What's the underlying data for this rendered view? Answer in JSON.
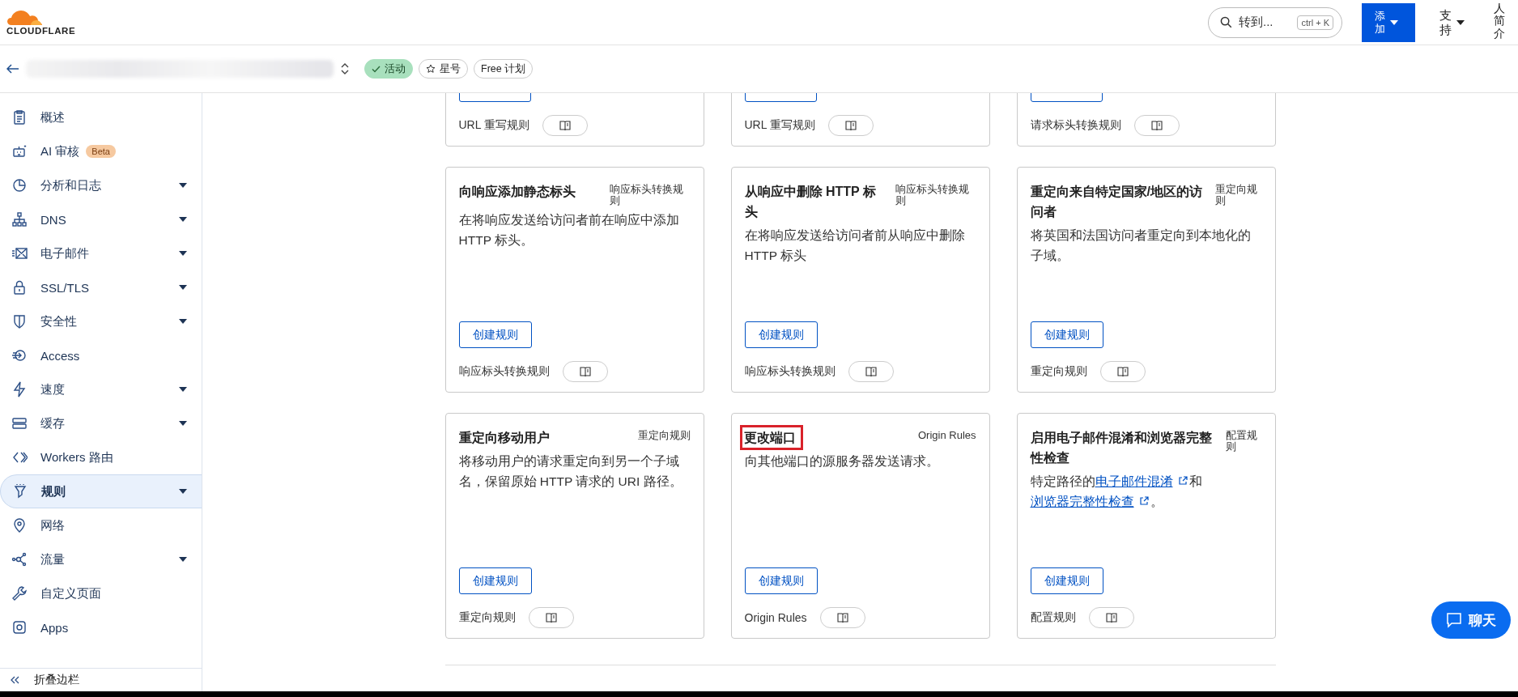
{
  "header": {
    "logo_text": "CLOUDFLARE",
    "search": {
      "placeholder": "转到...",
      "shortcut": "ctrl + K"
    },
    "add_button": "添加",
    "support": "支持",
    "profile": "人简介"
  },
  "zone_bar": {
    "badges": [
      {
        "kind": "status",
        "label": "活动"
      },
      {
        "kind": "star",
        "label": "星号"
      },
      {
        "kind": "plan",
        "label": "Free 计划"
      }
    ]
  },
  "sidebar": {
    "items": [
      {
        "label": "概述",
        "expandable": false,
        "selected": false
      },
      {
        "label": "AI 审核",
        "badge": "Beta",
        "expandable": false,
        "selected": false
      },
      {
        "label": "分析和日志",
        "expandable": true,
        "selected": false
      },
      {
        "label": "DNS",
        "expandable": true,
        "selected": false
      },
      {
        "label": "电子邮件",
        "expandable": true,
        "selected": false
      },
      {
        "label": "SSL/TLS",
        "expandable": true,
        "selected": false
      },
      {
        "label": "安全性",
        "expandable": true,
        "selected": false
      },
      {
        "label": "Access",
        "expandable": false,
        "selected": false
      },
      {
        "label": "速度",
        "expandable": true,
        "selected": false
      },
      {
        "label": "缓存",
        "expandable": true,
        "selected": false
      },
      {
        "label": "Workers 路由",
        "expandable": false,
        "selected": false
      },
      {
        "label": "规则",
        "expandable": true,
        "selected": true
      },
      {
        "label": "网络",
        "expandable": false,
        "selected": false
      },
      {
        "label": "流量",
        "expandable": true,
        "selected": false
      },
      {
        "label": "自定义页面",
        "expandable": false,
        "selected": false
      },
      {
        "label": "Apps",
        "expandable": false,
        "selected": false
      }
    ],
    "collapse": "折叠边栏"
  },
  "cards": [
    {
      "kind": "partial",
      "type_label": "URL 重写规则"
    },
    {
      "kind": "partial",
      "type_label": "URL 重写规则"
    },
    {
      "kind": "partial",
      "type_label": "请求标头转换规则"
    },
    {
      "kind": "full",
      "title": "向响应添加静态标头",
      "tag": "响应标头转换规则",
      "highlighted": false,
      "description": [
        {
          "kind": "text",
          "text": "在将响应发送给访问者前在响应中添加 HTTP 标头。"
        }
      ],
      "button": "创建规则",
      "type_label": "响应标头转换规则"
    },
    {
      "kind": "full",
      "title": "从响应中删除 HTTP 标头",
      "tag": "响应标头转换规则",
      "highlighted": false,
      "description": [
        {
          "kind": "text",
          "text": "在将响应发送给访问者前从响应中删除 HTTP 标头"
        }
      ],
      "button": "创建规则",
      "type_label": "响应标头转换规则"
    },
    {
      "kind": "full",
      "title": "重定向来自特定国家/地区的访问者",
      "tag": "重定向规则",
      "highlighted": false,
      "description": [
        {
          "kind": "text",
          "text": "将英国和法国访问者重定向到本地化的子域。"
        }
      ],
      "button": "创建规则",
      "type_label": "重定向规则"
    },
    {
      "kind": "full",
      "title": "重定向移动用户",
      "tag": "重定向规则",
      "highlighted": false,
      "description": [
        {
          "kind": "text",
          "text": "将移动用户的请求重定向到另一个子域名，保留原始 HTTP 请求的 URI 路径。"
        }
      ],
      "button": "创建规则",
      "type_label": "重定向规则"
    },
    {
      "kind": "full",
      "title": "更改端口",
      "tag": "Origin Rules",
      "highlighted": true,
      "description": [
        {
          "kind": "text",
          "text": "向其他端口的源服务器发送请求。"
        }
      ],
      "button": "创建规则",
      "type_label": "Origin Rules"
    },
    {
      "kind": "full",
      "title": "启用电子邮件混淆和浏览器完整性检查",
      "tag": "配置规则",
      "highlighted": false,
      "description": [
        {
          "kind": "text",
          "text": "特定路径的"
        },
        {
          "kind": "link",
          "text": "电子邮件混淆"
        },
        {
          "kind": "text",
          "text": "和"
        },
        {
          "kind": "link",
          "text": "浏览器完整性检查"
        },
        {
          "kind": "text",
          "text": "。"
        }
      ],
      "button": "创建规则",
      "type_label": "配置规则"
    }
  ],
  "chat_button": "聊天"
}
